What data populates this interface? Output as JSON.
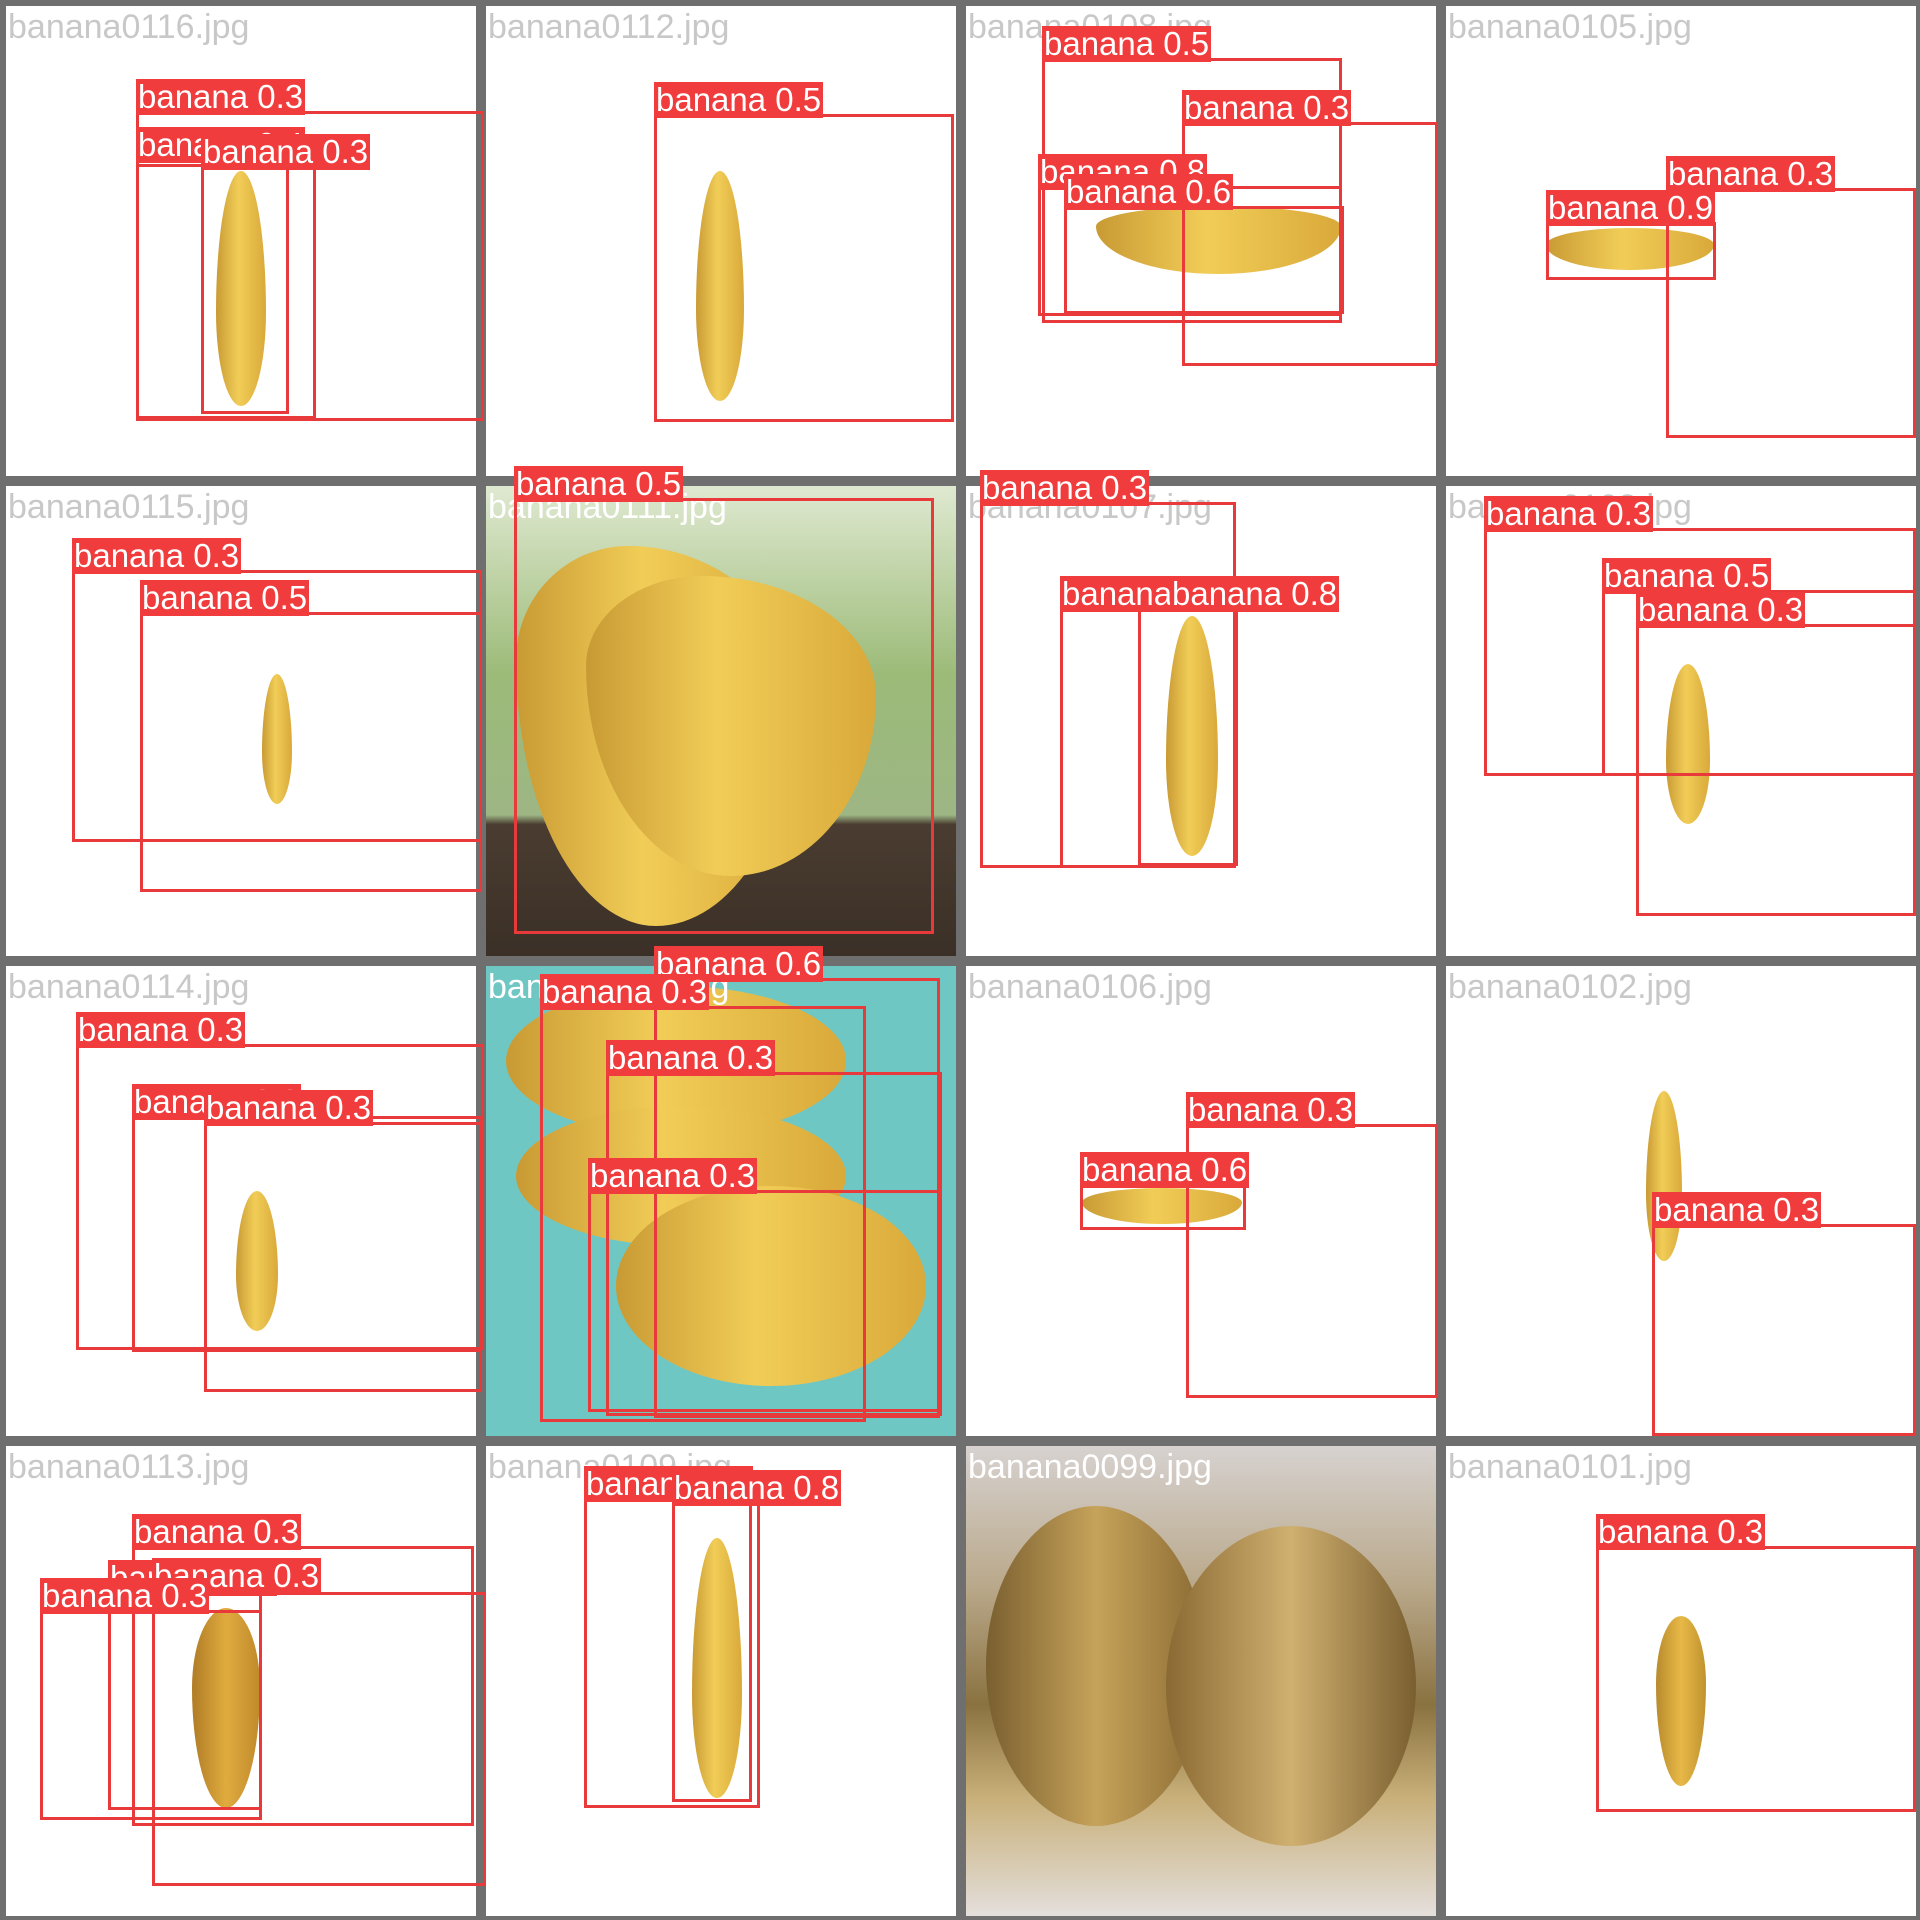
{
  "tiles": [
    {
      "file": "banana0116.jpg",
      "labels": [
        "banana 0.3",
        "banana 0.4",
        "banana 0.3"
      ]
    },
    {
      "file": "banana0112.jpg",
      "labels": [
        "banana 0.5"
      ]
    },
    {
      "file": "banana0108.jpg",
      "labels": [
        "banana 0.5",
        "banana 0.3",
        "banana 0.8",
        "banana 0.6"
      ]
    },
    {
      "file": "banana0105.jpg",
      "labels": [
        "banana 0.3",
        "banana 0.9"
      ]
    },
    {
      "file": "banana0115.jpg",
      "labels": [
        "banana 0.3",
        "banana 0.5"
      ]
    },
    {
      "file": "banana0111.jpg",
      "labels": [
        "banana 0.5"
      ]
    },
    {
      "file": "banana0107.jpg",
      "labels": [
        "banana 0.3",
        "banana 0.6",
        "banana 0.8"
      ]
    },
    {
      "file": "banana0103.jpg",
      "labels": [
        "banana 0.3",
        "banana 0.5",
        "banana 0.3"
      ]
    },
    {
      "file": "banana0114.jpg",
      "labels": [
        "banana 0.3",
        "banana 0.3",
        "banana 0.3"
      ]
    },
    {
      "file": "banana0110.jpg",
      "labels": [
        "banana 0.6",
        "banana 0.3",
        "banana 0.3",
        "banana 0.3"
      ]
    },
    {
      "file": "banana0106.jpg",
      "labels": [
        "banana 0.3",
        "banana 0.6"
      ]
    },
    {
      "file": "banana0102.jpg",
      "labels": [
        "banana 0.3"
      ]
    },
    {
      "file": "banana0113.jpg",
      "labels": [
        "banana 0.3",
        "banana 0.3",
        "banana 0.3",
        "banana 0.3"
      ]
    },
    {
      "file": "banana0109.jpg",
      "labels": [
        "banana 0.3",
        "banana 0.8"
      ]
    },
    {
      "file": "banana0099.jpg",
      "labels": []
    },
    {
      "file": "banana0101.jpg",
      "labels": [
        "banana 0.3"
      ]
    }
  ]
}
